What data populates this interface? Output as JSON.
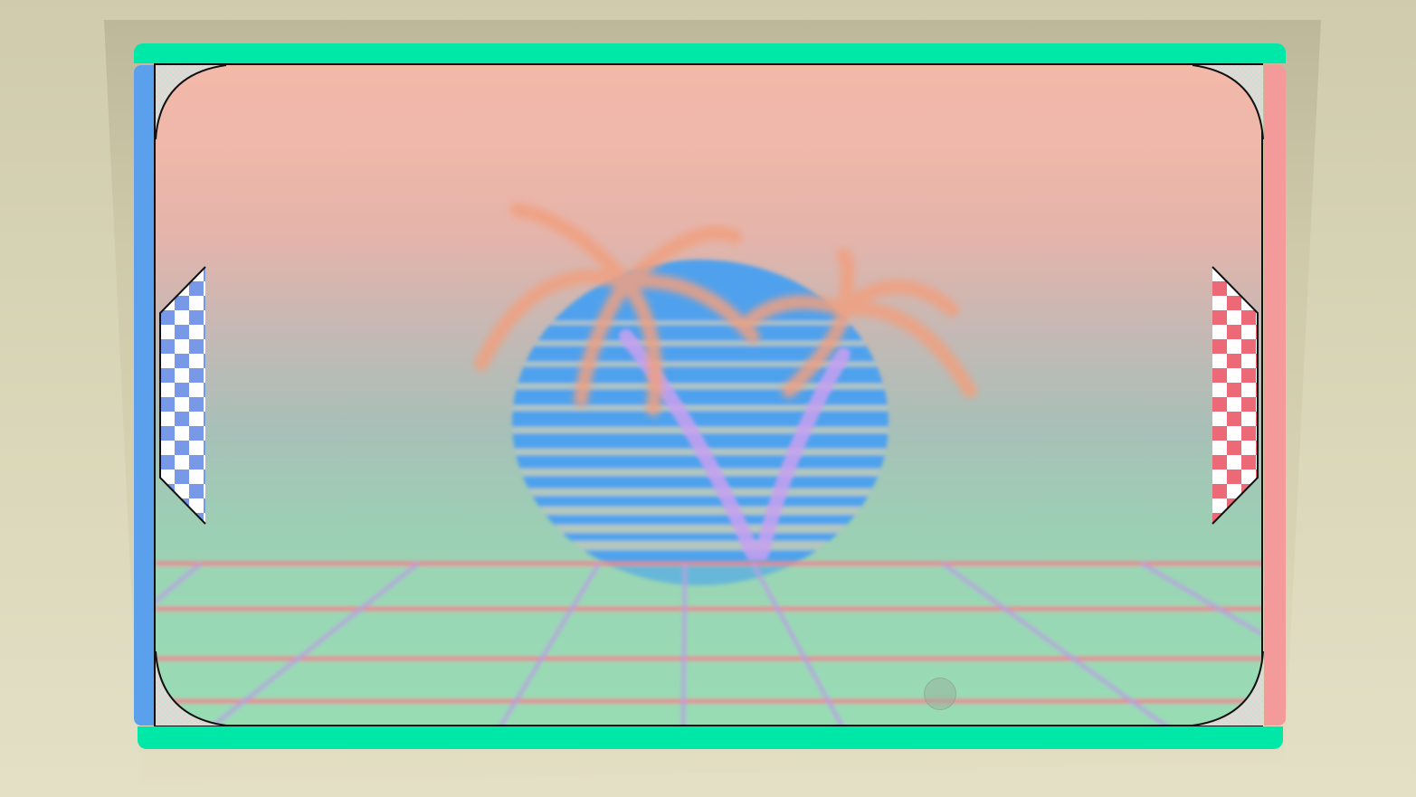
{
  "game": {
    "name": "retro-pong",
    "colors": {
      "bezel": "#d8d4b4",
      "rail": "#00e8a8",
      "left_goal": "#5aa0ec",
      "right_goal": "#f49a9a",
      "left_paddle_check": "#7898e8",
      "right_paddle_check": "#ec6a78",
      "sun": "#4aa0f0",
      "palm": "#f0a080",
      "grid_line": "#f08090",
      "sky_top": "#f2b8a8",
      "floor": "#98dcb4"
    },
    "icons": {
      "left_paddle": "checkered-paddle-icon",
      "right_paddle": "checkered-paddle-icon",
      "ball": "ball-icon",
      "background": "synthwave-sun-palm-icon"
    }
  }
}
